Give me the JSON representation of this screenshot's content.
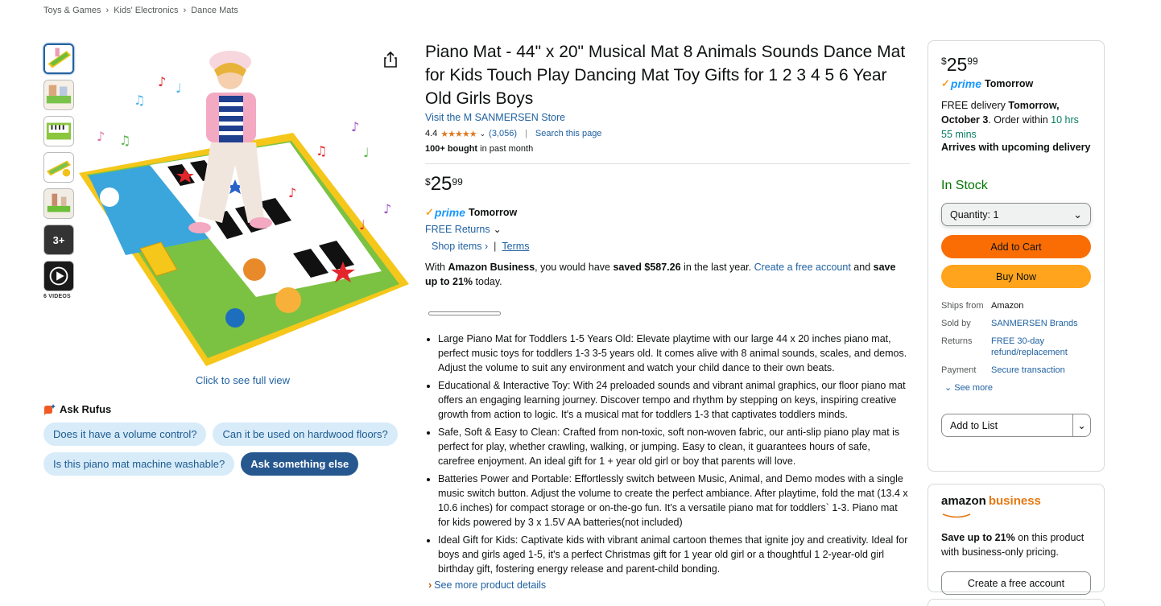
{
  "breadcrumb": [
    "Toys & Games",
    "Kids' Electronics",
    "Dance Mats"
  ],
  "gallery": {
    "more_label": "3+",
    "videos_label": "6 VIDEOS",
    "full_view_label": "Click to see full view"
  },
  "rufus": {
    "title": "Ask Rufus",
    "chips": [
      "Does it have a volume control?",
      "Can it be used on hardwood floors?",
      "Is this piano mat machine washable?"
    ],
    "ask_button": "Ask something else"
  },
  "product": {
    "title": "Piano Mat - 44\" x 20\" Musical Mat 8 Animals Sounds Dance Mat for Kids Touch Play Dancing Mat Toy Gifts for 1 2 3 4 5 6 Year Old Girls Boys",
    "store_link": "Visit the M SANMERSEN Store",
    "rating": "4.4",
    "stars": "★★★★★",
    "rating_count": "(3,056)",
    "search_page": "Search this page",
    "bought_bold": "100+ bought",
    "bought_rest": " in past month",
    "price_symbol": "$",
    "price_whole": "25",
    "price_fraction": "99",
    "prime_word": "prime",
    "prime_tomorrow": "Tomorrow",
    "free_returns": "FREE Returns",
    "shop_items": "Shop items ›",
    "terms": "Terms",
    "business_with": "With ",
    "business_bold1": "Amazon Business",
    "business_mid": ", you would have ",
    "business_bold2": "saved $587.26",
    "business_tail": " in the last year. ",
    "business_link": "Create a free account",
    "business_and": " and ",
    "business_bold3": "save up to 21%",
    "business_end": " today.",
    "bullets": [
      "Large Piano Mat for Toddlers 1-5 Years Old: Elevate playtime with our large 44 x 20 inches piano mat, perfect music toys for toddlers 1-3 3-5 years old. It comes alive with 8 animal sounds, scales, and demos. Adjust the volume to suit any environment and watch your child dance to their own beats.",
      "Educational & Interactive Toy: With 24 preloaded sounds and vibrant animal graphics, our floor piano mat offers an engaging learning journey. Discover tempo and rhythm by stepping on keys, inspiring creative growth from action to logic. It's a musical mat for toddlers 1-3 that captivates toddlers minds.",
      "Safe, Soft & Easy to Clean: Crafted from non-toxic, soft non-woven fabric, our anti-slip piano play mat is perfect for play, whether crawling, walking, or jumping. Easy to clean, it guarantees hours of safe, carefree enjoyment. An ideal gift for 1 + year old girl or boy that parents will love.",
      "Batteries Power and Portable: Effortlessly switch between Music, Animal, and Demo modes with a single music switch button. Adjust the volume to create the perfect ambiance. After playtime, fold the mat (13.4 x 10.6 inches) for compact storage or on-the-go fun. It's a versatile piano mat for toddlers` 1-3. Piano mat for kids powered by 3 x 1.5V AA batteries(not included)",
      "Ideal Gift for Kids: Captivate kids with vibrant animal cartoon themes that ignite joy and creativity. Ideal for boys and girls aged 1-5, it's a perfect Christmas gift for 1 year old girl or a thoughtful 1 2-year-old girl birthday gift, fostering energy release and parent-child bonding."
    ],
    "see_more_details": "See more product details"
  },
  "buybox": {
    "price_symbol": "$",
    "price_whole": "25",
    "price_fraction": "99",
    "prime_word": "prime",
    "prime_tomorrow": "Tomorrow",
    "delivery_pre": "FREE delivery ",
    "delivery_bold": "Tomorrow, October 3",
    "delivery_mid": ". Order within ",
    "delivery_countdown": "10 hrs 55 mins",
    "arrives": "Arrives with upcoming delivery",
    "stock": "In Stock",
    "quantity": "Quantity:  1",
    "add_to_cart": "Add to Cart",
    "buy_now": "Buy Now",
    "meta": [
      {
        "k": "Ships from",
        "v": "Amazon",
        "link": false
      },
      {
        "k": "Sold by",
        "v": "SANMERSEN Brands",
        "link": true
      },
      {
        "k": "Returns",
        "v": "FREE 30-day refund/replacement",
        "link": true
      },
      {
        "k": "Payment",
        "v": "Secure transaction",
        "link": true
      }
    ],
    "see_more": "See more",
    "add_to_list": "Add to List"
  },
  "business_box": {
    "logo_amazon": "amazon",
    "logo_business": "business",
    "text_bold": "Save up to 21%",
    "text_rest": " on this product with business-only pricing.",
    "button": "Create a free account"
  },
  "colors": {
    "link": "#2162a1",
    "cart": "#fa6d05",
    "buy": "#ffa41c",
    "stock": "#007600",
    "prime": "#1a98ff",
    "star": "#de7921"
  }
}
